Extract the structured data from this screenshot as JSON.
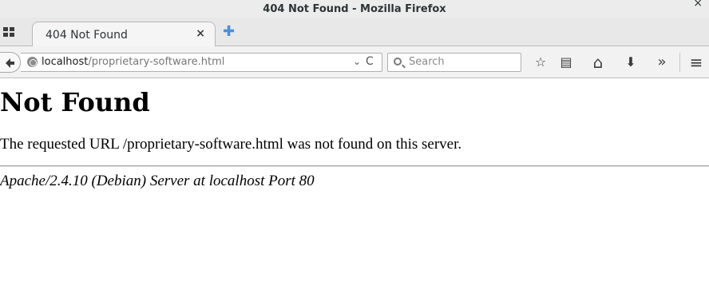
{
  "window": {
    "title": "404 Not Found - Mozilla Firefox",
    "close_glyph": "×"
  },
  "tabs": [
    {
      "label": "404 Not Found",
      "close_glyph": "×",
      "active": true
    }
  ],
  "tabstrip": {
    "new_tab_glyph": "✚",
    "tab_groups_icon": "grid-icon"
  },
  "navbar": {
    "back_icon": "back-arrow-icon",
    "url_host": "localhost",
    "url_path": "/proprietary-software.html",
    "url_dropdown_glyph": "⌄",
    "reload_glyph": "C",
    "search_placeholder": "Search",
    "toolbar_icons": [
      {
        "name": "bookmark-star-icon",
        "glyph": "☆"
      },
      {
        "name": "reading-list-icon",
        "glyph": "▤"
      },
      {
        "name": "home-icon",
        "glyph": "⌂"
      },
      {
        "name": "download-icon",
        "glyph": "⬇"
      },
      {
        "name": "overflow-chevron-icon",
        "glyph": "»"
      },
      {
        "name": "hamburger-menu-icon",
        "glyph": "≡"
      }
    ]
  },
  "page": {
    "heading": "Not Found",
    "message": "The requested URL /proprietary-software.html was not found on this server.",
    "address": "Apache/2.4.10 (Debian) Server at localhost Port 80"
  },
  "colors": {
    "titlebar_bg": "#ececec",
    "chrome_bg": "#f2f2f2",
    "new_tab_accent": "#4a90d9",
    "page_bg": "#ffffff",
    "text": "#000000"
  }
}
